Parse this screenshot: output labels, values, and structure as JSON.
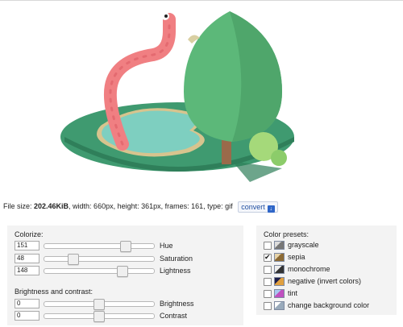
{
  "file_info": {
    "size_label": "File size: ",
    "size_value": "202.46KiB",
    "rest": ", width: 660px, height: 361px, frames: 161, type: gif",
    "convert_label": "convert"
  },
  "colorize": {
    "title": "Colorize:",
    "rows": [
      {
        "value": "151",
        "label": "Hue",
        "level": 0.77
      },
      {
        "value": "48",
        "label": "Saturation",
        "level": 0.24
      },
      {
        "value": "148",
        "label": "Lightness",
        "level": 0.74
      }
    ]
  },
  "brightness_contrast": {
    "title": "Brightness and contrast:",
    "rows": [
      {
        "value": "0",
        "label": "Brightness",
        "level": 0.5
      },
      {
        "value": "0",
        "label": "Contrast",
        "level": 0.5
      }
    ]
  },
  "color_presets": {
    "title": "Color presets:",
    "items": [
      {
        "label": "grayscale",
        "checked": false,
        "icon": "grayscale-icon"
      },
      {
        "label": "sepia",
        "checked": true,
        "icon": "sepia-icon"
      },
      {
        "label": "monochrome",
        "checked": false,
        "icon": "monochrome-icon"
      },
      {
        "label": "negative (invert colors)",
        "checked": false,
        "icon": "negative-icon"
      },
      {
        "label": "tint",
        "checked": false,
        "icon": "tint-icon"
      },
      {
        "label": "change background color",
        "checked": false,
        "icon": "background-color-icon"
      }
    ]
  },
  "colors": {
    "panel_bg": "#f3f3f3",
    "grass_dark": "#3f9a70",
    "water": "#7ecfc0",
    "tree": "#5cb879",
    "worm": "#f07f82",
    "link": "#1f4ea0"
  }
}
